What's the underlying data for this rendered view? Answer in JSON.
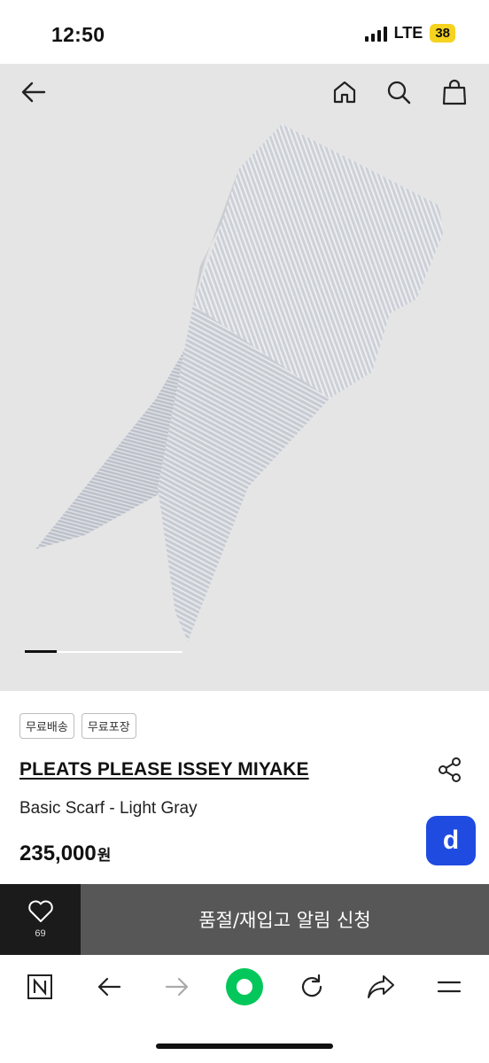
{
  "status_bar": {
    "time": "12:50",
    "network": "LTE",
    "battery": "38"
  },
  "nav": {
    "icons": [
      "back-arrow-icon",
      "home-icon",
      "search-icon",
      "shopping-bag-icon"
    ]
  },
  "gallery": {
    "current_index": 1,
    "image": "light-gray-pleated-scarf"
  },
  "product": {
    "tags": [
      "무료배송",
      "무료포장"
    ],
    "brand": "PLEATS PLEASE ISSEY MIYAKE",
    "name": "Basic Scarf - Light Gray",
    "price": "235,000",
    "currency": "원",
    "d_label": "d"
  },
  "action_bar": {
    "wishlist_count": "69",
    "restock_label": "품절/재입고 알림 신청"
  },
  "colors": {
    "accent_blue": "#1f4be0",
    "battery_yellow": "#f5d31f",
    "naver_green": "#03c75a",
    "wish_bg": "#1b1b1b",
    "restock_bg": "#575757"
  }
}
